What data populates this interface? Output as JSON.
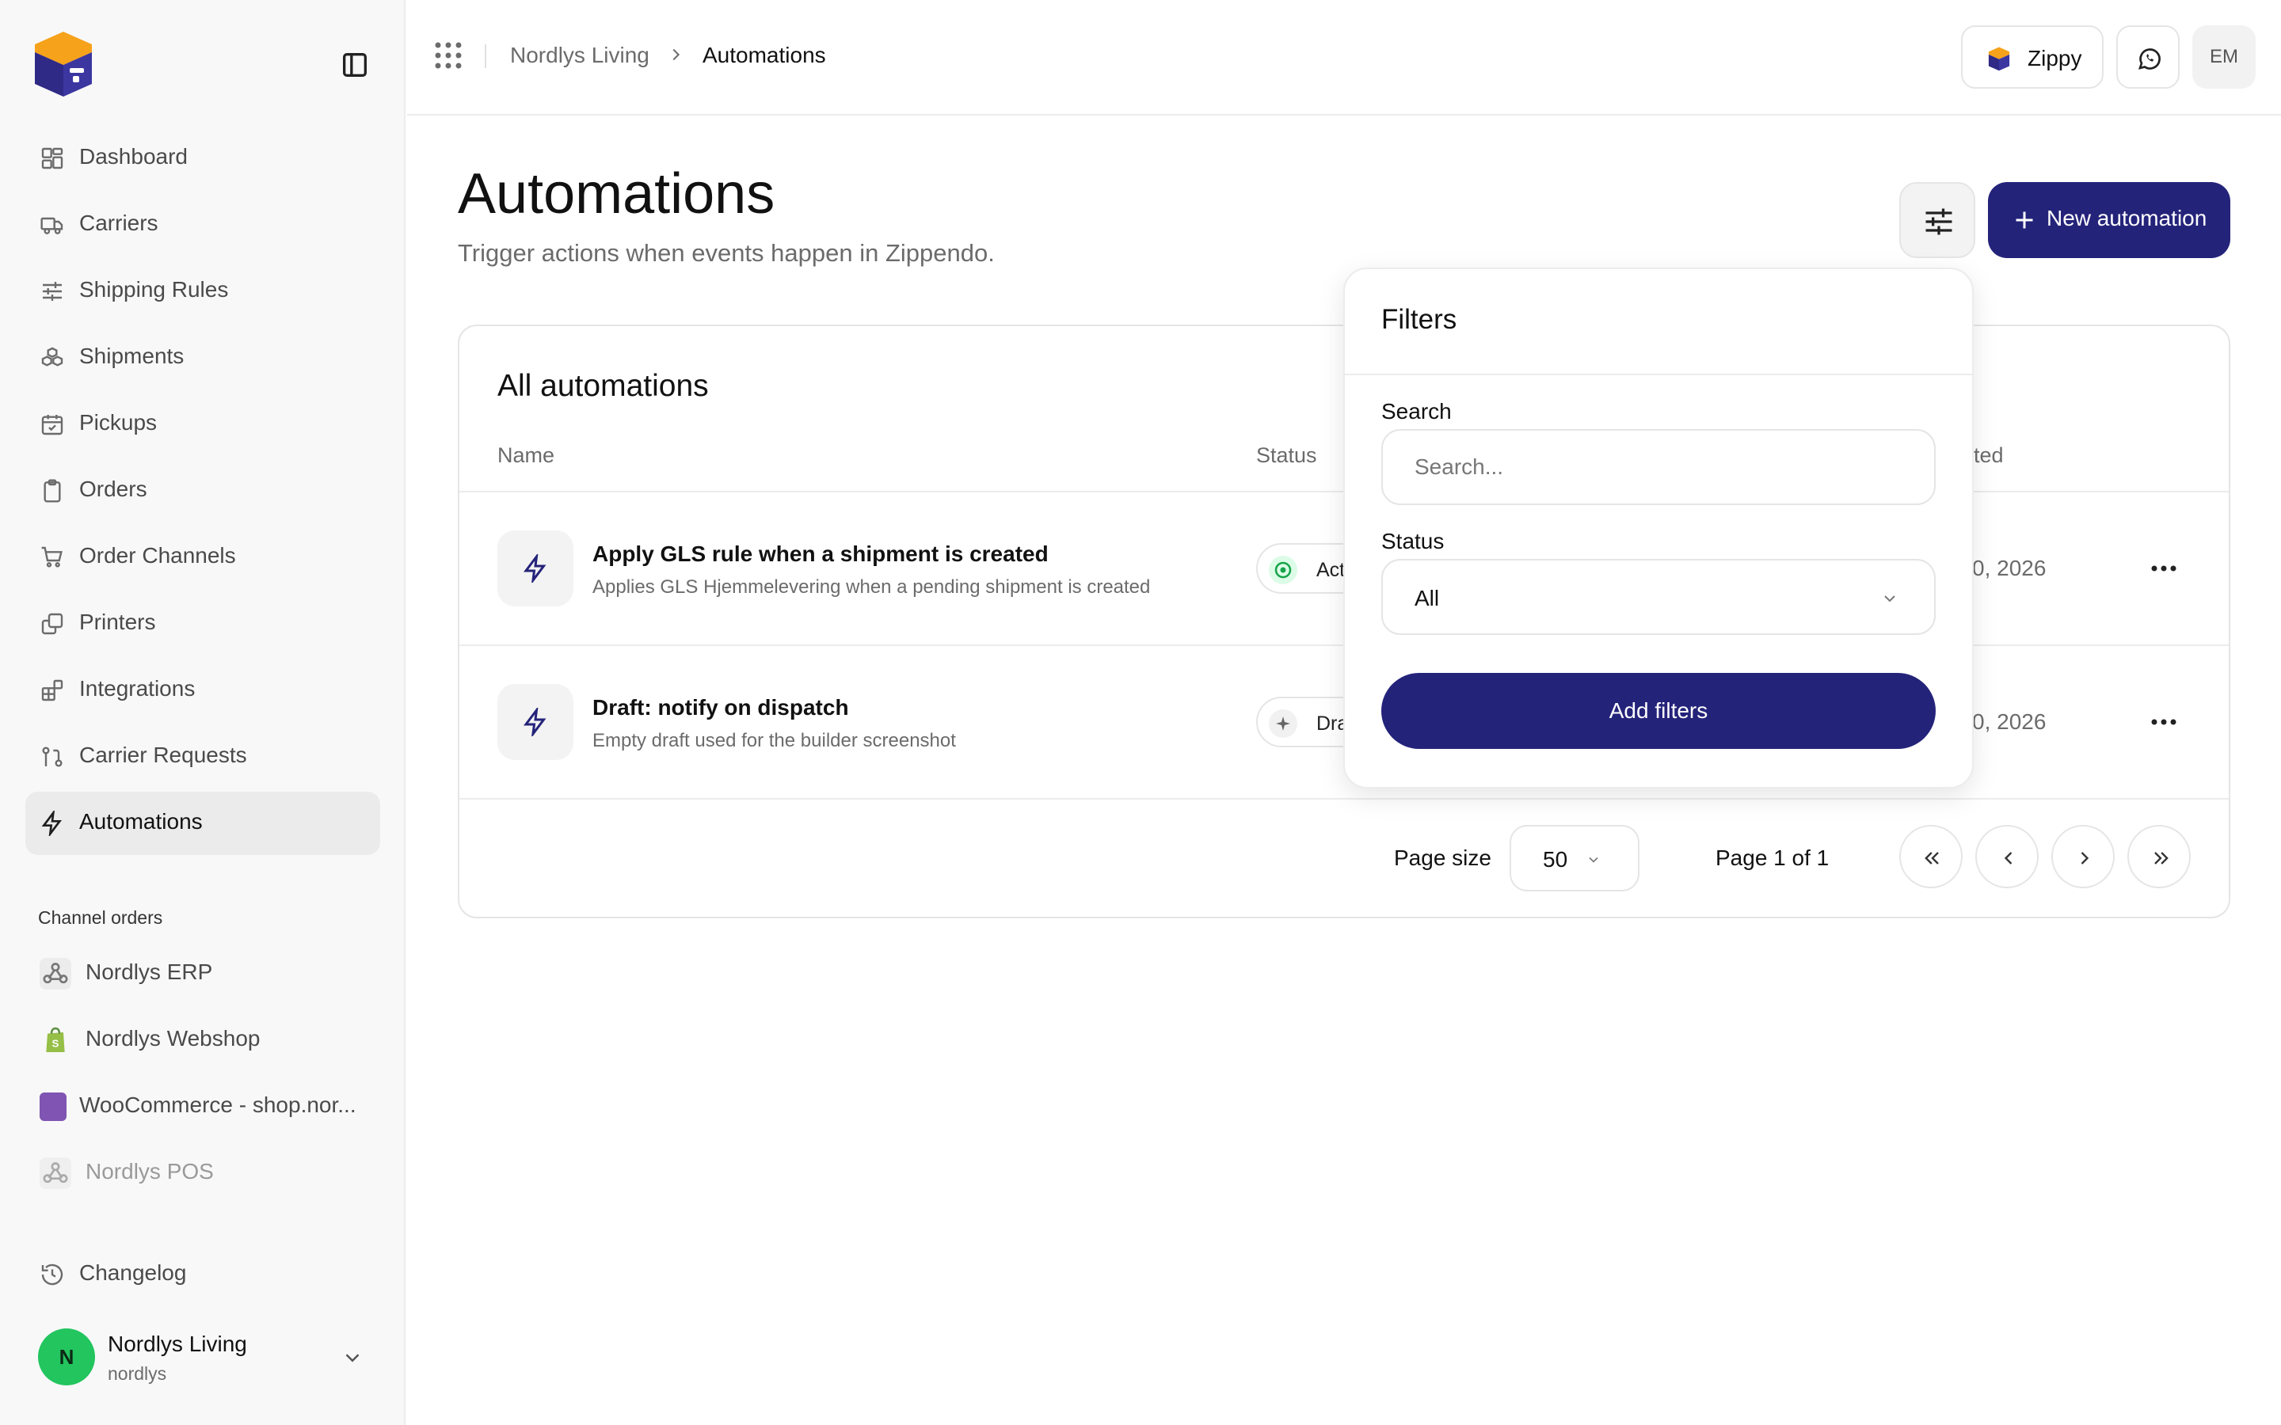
{
  "sidebar": {
    "nav": [
      {
        "label": "Dashboard",
        "icon": "dashboard-icon"
      },
      {
        "label": "Carriers",
        "icon": "truck-icon"
      },
      {
        "label": "Shipping Rules",
        "icon": "sliders-icon"
      },
      {
        "label": "Shipments",
        "icon": "boxes-icon"
      },
      {
        "label": "Pickups",
        "icon": "calendar-check-icon"
      },
      {
        "label": "Orders",
        "icon": "clipboard-icon"
      },
      {
        "label": "Order Channels",
        "icon": "cart-icon"
      },
      {
        "label": "Printers",
        "icon": "copy-icon"
      },
      {
        "label": "Integrations",
        "icon": "blocks-icon"
      },
      {
        "label": "Carrier Requests",
        "icon": "git-pull-icon"
      },
      {
        "label": "Automations",
        "icon": "bolt-icon",
        "active": true
      }
    ],
    "channels_title": "Channel orders",
    "channels": [
      {
        "label": "Nordlys ERP",
        "icon": "webhook-icon"
      },
      {
        "label": "Nordlys Webshop",
        "icon": "shopify-icon"
      },
      {
        "label": "WooCommerce - shop.nor...",
        "icon": "woocommerce-icon"
      },
      {
        "label": "Nordlys POS",
        "icon": "webhook-icon",
        "dimmed": true
      }
    ],
    "changelog": "Changelog",
    "user": {
      "initial": "N",
      "name": "Nordlys Living",
      "handle": "nordlys"
    }
  },
  "topbar": {
    "breadcrumb": [
      "Nordlys Living",
      "Automations"
    ],
    "zippy_label": "Zippy",
    "avatar_initials": "EM"
  },
  "page": {
    "title": "Automations",
    "subtitle": "Trigger actions when events happen in Zippendo.",
    "new_button": "New automation"
  },
  "table": {
    "title": "All automations",
    "columns": {
      "name": "Name",
      "status": "Status",
      "updated_partial": "ted"
    },
    "rows": [
      {
        "title": "Apply GLS rule when a shipment is created",
        "desc": "Applies GLS Hjemmelevering when a pending shipment is created",
        "status": "Act",
        "date": "0, 2026"
      },
      {
        "title": "Draft: notify on dispatch",
        "desc": "Empty draft used for the builder screenshot",
        "status": "Dra",
        "date": "0, 2026"
      }
    ],
    "pagination": {
      "page_size_label": "Page size",
      "page_size": "50",
      "page_info": "Page 1 of 1"
    }
  },
  "filters": {
    "title": "Filters",
    "search_label": "Search",
    "search_placeholder": "Search...",
    "search_value": "",
    "status_label": "Status",
    "status_value": "All",
    "submit": "Add filters"
  },
  "colors": {
    "accent": "#24237a",
    "logo_orange": "#f6a21a",
    "logo_blue": "#2f2a86",
    "active_green": "#22c55e"
  }
}
